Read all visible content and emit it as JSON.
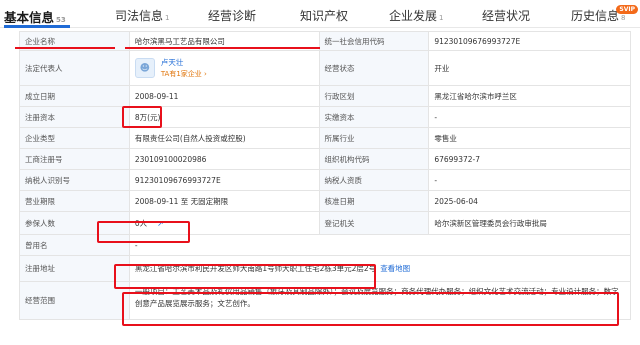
{
  "tabs": [
    {
      "label": "基本信息",
      "count": "53"
    },
    {
      "label": "司法信息",
      "count": "1"
    },
    {
      "label": "经营诊断",
      "count": ""
    },
    {
      "label": "知识产权",
      "count": ""
    },
    {
      "label": "企业发展",
      "count": "1"
    },
    {
      "label": "经营状况",
      "count": ""
    },
    {
      "label": "历史信息",
      "count": "8"
    }
  ],
  "badge": "SVIP",
  "info": {
    "company_name_label": "企业名称",
    "company_name": "哈尔滨黑马工艺品有限公司",
    "credit_code_label": "统一社会信用代码",
    "credit_code": "91230109676993727E",
    "legal_rep_label": "法定代表人",
    "legal_rep_name": "卢天壮",
    "legal_rep_sub": "TA有1家企业 ›",
    "op_status_label": "经营状态",
    "op_status": "开业",
    "founded_label": "成立日期",
    "founded": "2008-09-11",
    "district_label": "行政区划",
    "district": "黑龙江省哈尔滨市呼兰区",
    "capital_label": "注册资本",
    "capital": "8万(元)",
    "paid_capital_label": "实缴资本",
    "paid_capital": "-",
    "type_label": "企业类型",
    "type": "有限责任公司(自然人投资或控股)",
    "industry_label": "所属行业",
    "industry": "零售业",
    "reg_no_label": "工商注册号",
    "reg_no": "230109100020986",
    "org_code_label": "组织机构代码",
    "org_code": "67699372-7",
    "taxpayer_id_label": "纳税人识别号",
    "taxpayer_id": "91230109676993727E",
    "taxpayer_q_label": "纳税人资质",
    "taxpayer_q": "-",
    "term_label": "营业期限",
    "term": "2008-09-11 至 无固定期限",
    "approve_label": "核准日期",
    "approve": "2025-06-04",
    "insured_label": "参保人数",
    "insured": "0人",
    "authority_label": "登记机关",
    "authority": "哈尔滨新区管理委员会行政审批局",
    "former_label": "曾用名",
    "former": "-",
    "address_label": "注册地址",
    "address": "黑龙江省哈尔滨市利民开发区师大南路1号师大职工住宅2栋3单元2层2号",
    "address_link": "查看地图",
    "scope_label": "经营范围",
    "scope": "一般项目：工艺美术品及礼仪用品销售（象牙及其制品除外）；会议及展览服务；商务代理代办服务；组织文化艺术交流活动；专业设计服务；数字创意产品展览展示服务；文艺创作。"
  },
  "colors": {
    "accent": "#1f6bd6",
    "annotation": "#e8101b",
    "label_bg": "#f5f8fc"
  }
}
